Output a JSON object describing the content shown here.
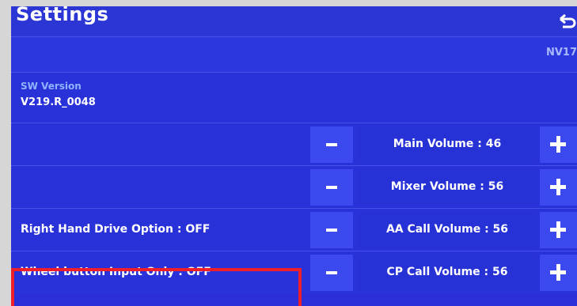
{
  "header": {
    "title": "Settings",
    "back_icon": "back-arrow-icon"
  },
  "model": {
    "label": "NV17"
  },
  "version": {
    "label": "SW Version",
    "value": "V219.R_0048"
  },
  "rows": [
    {
      "left_text": "",
      "volume_label": "Main Volume : 46",
      "minus_icon": "minus-icon",
      "plus_icon": "plus-icon"
    },
    {
      "left_text": "",
      "volume_label": "Mixer Volume : 56",
      "minus_icon": "minus-icon",
      "plus_icon": "plus-icon"
    },
    {
      "left_text": "Right Hand Drive Option : OFF",
      "volume_label": "AA Call Volume : 56",
      "minus_icon": "minus-icon",
      "plus_icon": "plus-icon"
    },
    {
      "left_text": "Wheel button Input Only : OFF",
      "volume_label": "CP Call Volume : 56",
      "minus_icon": "minus-icon",
      "plus_icon": "plus-icon"
    }
  ],
  "colors": {
    "panel_blue": "#2a2fd8",
    "button_blue": "#3b49ee",
    "highlight_red": "#ee1e2a",
    "sw_label_blue": "#8fb3ff"
  }
}
